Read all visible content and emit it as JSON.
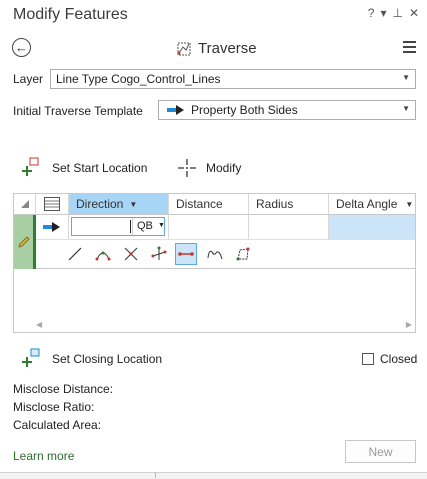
{
  "pane": {
    "title": "Modify Features",
    "help": "?",
    "menu": "▾",
    "pin": "⊥",
    "close": "✕"
  },
  "tool": {
    "title": "Traverse"
  },
  "layer": {
    "label": "Layer",
    "value": "Line Type Cogo_Control_Lines"
  },
  "template": {
    "label": "Initial Traverse Template",
    "value": "Property Both Sides"
  },
  "actions": {
    "set_start": "Set Start Location",
    "modify": "Modify",
    "set_closing": "Set Closing Location"
  },
  "grid": {
    "columns": [
      "Direction",
      "Distance",
      "Radius",
      "Delta Angle"
    ],
    "direction_unit": "QB",
    "tools": [
      "line-segment-icon",
      "two-line-arc-icon",
      "intersect-icon",
      "tangent-icon",
      "segment-constrained-icon",
      "spiral-icon",
      "polygon-close-icon"
    ]
  },
  "closed": {
    "label": "Closed",
    "checked": false
  },
  "stats": {
    "misclose_distance": "Misclose Distance:",
    "misclose_ratio": "Misclose Ratio:",
    "calculated_area": "Calculated Area:"
  },
  "footer": {
    "learn_more": "Learn more",
    "new_button": "New"
  },
  "colors": {
    "accent": "#a8d5f5",
    "green_bar": "#2e7d32",
    "selected_tool": "#c0392b"
  }
}
